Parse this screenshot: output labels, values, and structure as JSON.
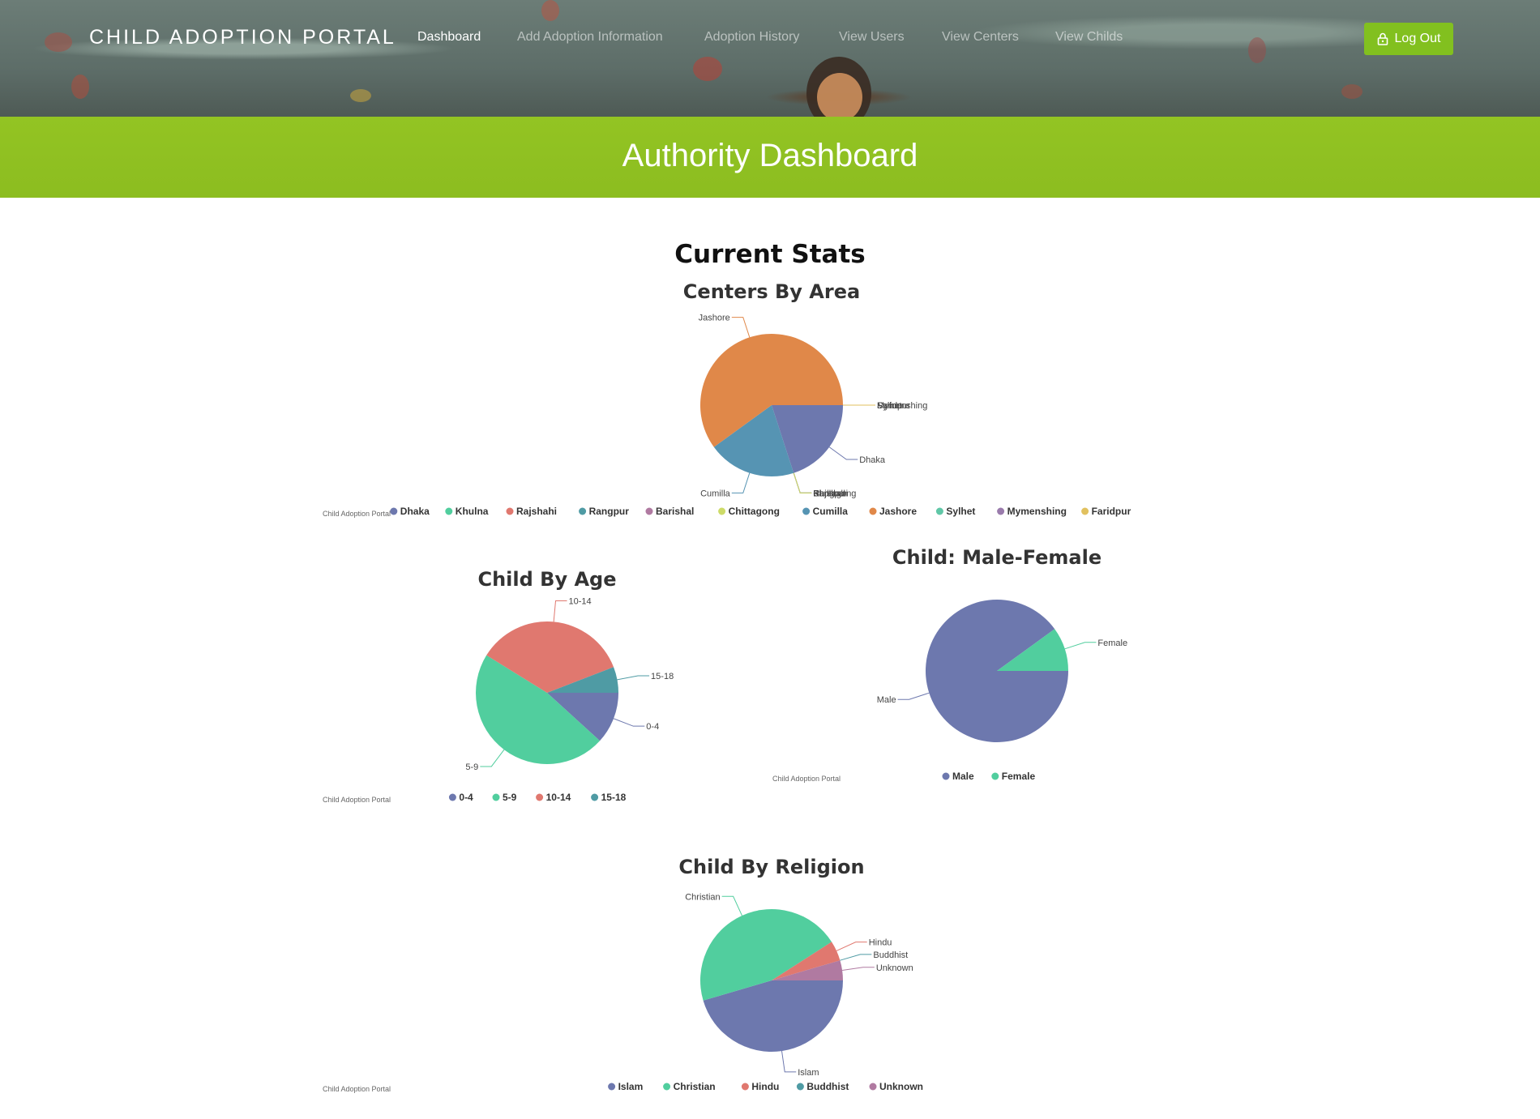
{
  "navbar": {
    "brand": "CHILD ADOPTION PORTAL",
    "items": [
      {
        "label": "Dashboard",
        "active": true
      },
      {
        "label": "Add Adoption Information",
        "active": false
      },
      {
        "label": "Adoption History",
        "active": false
      },
      {
        "label": "View Users",
        "active": false
      },
      {
        "label": "View Centers",
        "active": false
      },
      {
        "label": "View Childs",
        "active": false
      }
    ],
    "logout_label": "Log Out",
    "logout_icon": "lock-icon"
  },
  "banner": {
    "title": "Authority Dashboard"
  },
  "main": {
    "heading": "Current Stats"
  },
  "colors": {
    "accent": "#8cbd20",
    "series": [
      "#6d78ae",
      "#51ce9e",
      "#e0786f",
      "#4f9ba4",
      "#b07aa1",
      "#cddb68",
      "#5694b3",
      "#e08849",
      "#60c7a7",
      "#9a7bac",
      "#e1c15f"
    ]
  },
  "chart_data": [
    {
      "type": "pie",
      "title": "Centers By Area",
      "credit": "Child Adoption Portal",
      "categories": [
        "Dhaka",
        "Khulna",
        "Rajshahi",
        "Rangpur",
        "Barishal",
        "Chittagong",
        "Cumilla",
        "Jashore",
        "Sylhet",
        "Mymenshing",
        "Faridpur"
      ],
      "values": [
        2,
        0,
        0,
        0,
        0,
        0,
        2,
        6,
        0,
        0,
        0
      ],
      "colors": [
        "#6d78ae",
        "#51ce9e",
        "#e0786f",
        "#4f9ba4",
        "#b07aa1",
        "#cddb68",
        "#5694b3",
        "#e08849",
        "#60c7a7",
        "#9a7bac",
        "#e1c15f"
      ],
      "legend": "bottom"
    },
    {
      "type": "pie",
      "title": "Child By Age",
      "credit": "Child Adoption Portal",
      "categories": [
        "0-4",
        "5-9",
        "10-14",
        "15-18"
      ],
      "values": [
        1,
        4,
        3,
        0.5
      ],
      "colors": [
        "#6d78ae",
        "#51ce9e",
        "#e0786f",
        "#4f9ba4"
      ],
      "legend": "bottom"
    },
    {
      "type": "pie",
      "title": "Child: Male-Female",
      "credit": "Child Adoption Portal",
      "categories": [
        "Male",
        "Female"
      ],
      "values": [
        9,
        1
      ],
      "colors": [
        "#6d78ae",
        "#51ce9e"
      ],
      "legend": "bottom"
    },
    {
      "type": "pie",
      "title": "Child By Religion",
      "credit": "Child Adoption Portal",
      "categories": [
        "Islam",
        "Christian",
        "Hindu",
        "Buddhist",
        "Unknown"
      ],
      "values": [
        10,
        10,
        1,
        0,
        1
      ],
      "colors": [
        "#6d78ae",
        "#51ce9e",
        "#e0786f",
        "#4f9ba4",
        "#b07aa1"
      ],
      "legend": "bottom"
    }
  ]
}
